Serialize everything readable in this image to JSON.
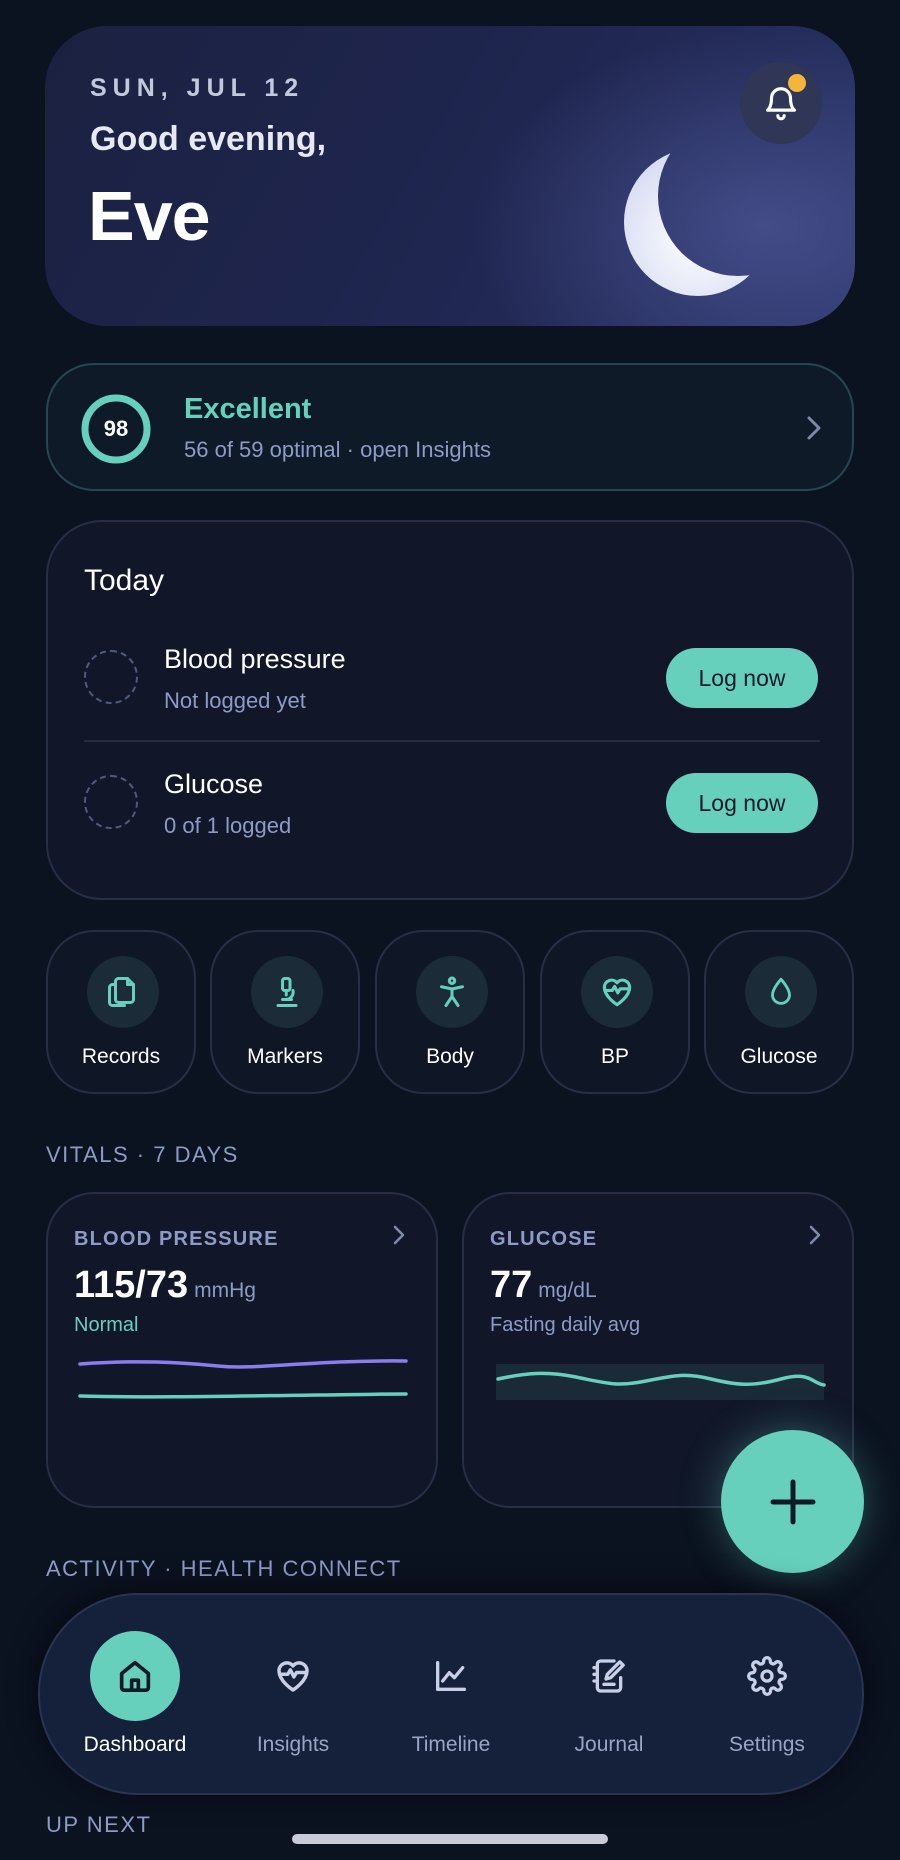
{
  "header": {
    "date": "SUN, JUL 12",
    "greeting": "Good evening,",
    "name": "Eve"
  },
  "score": {
    "value": "98",
    "title": "Excellent",
    "subtitle": "56 of 59 optimal · open Insights"
  },
  "today": {
    "title": "Today",
    "items": [
      {
        "title": "Blood pressure",
        "subtitle": "Not logged yet",
        "button": "Log now"
      },
      {
        "title": "Glucose",
        "subtitle": "0 of 1 logged",
        "button": "Log now"
      }
    ]
  },
  "shortcuts": [
    {
      "label": "Records",
      "icon": "records-icon"
    },
    {
      "label": "Markers",
      "icon": "microscope-icon"
    },
    {
      "label": "Body",
      "icon": "body-icon"
    },
    {
      "label": "BP",
      "icon": "heart-pulse-icon"
    },
    {
      "label": "Glucose",
      "icon": "drop-icon"
    }
  ],
  "vitals": {
    "heading": "VITALS · 7 DAYS",
    "blood_pressure": {
      "label": "BLOOD PRESSURE",
      "value": "115/73",
      "unit": "mmHg",
      "note": "Normal"
    },
    "glucose": {
      "label": "GLUCOSE",
      "value": "77",
      "unit": "mg/dL",
      "note": "Fasting daily avg"
    }
  },
  "activity_heading": "ACTIVITY · HEALTH CONNECT",
  "up_next_heading": "UP NEXT",
  "nav": [
    {
      "label": "Dashboard",
      "icon": "home-icon",
      "active": true
    },
    {
      "label": "Insights",
      "icon": "heart-pulse-icon",
      "active": false
    },
    {
      "label": "Timeline",
      "icon": "chart-line-icon",
      "active": false
    },
    {
      "label": "Journal",
      "icon": "journal-icon",
      "active": false
    },
    {
      "label": "Settings",
      "icon": "gear-icon",
      "active": false
    }
  ],
  "colors": {
    "accent": "#66d0bd",
    "systolic_line": "#8b7cf0",
    "diastolic_line": "#66d0bd",
    "notification_dot": "#f4b63a"
  }
}
